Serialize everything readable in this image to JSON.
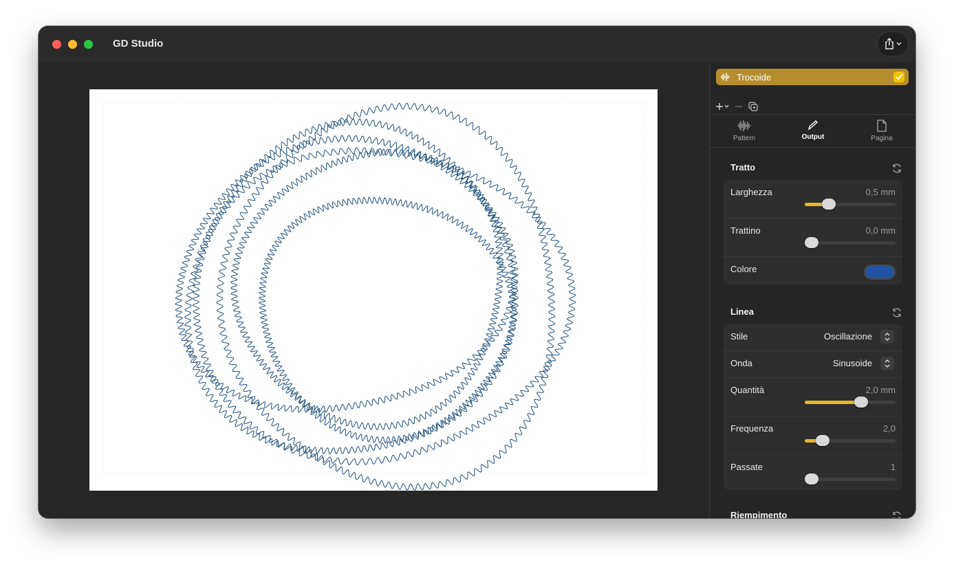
{
  "window": {
    "title": "GD Studio"
  },
  "canvas": {
    "stroke_color": "#1f4e7a"
  },
  "layer": {
    "name": "Trocoide",
    "color": "#b58d2e"
  },
  "tabs": [
    {
      "label": "Pattern",
      "icon": "waveform-icon"
    },
    {
      "label": "Output",
      "icon": "pencil-icon"
    },
    {
      "label": "Pagina",
      "icon": "document-icon"
    }
  ],
  "tratto": {
    "title": "Tratto",
    "larghezza": {
      "label": "Larghezza",
      "value": "0,5 mm",
      "fraction": 0.22
    },
    "trattino": {
      "label": "Trattino",
      "value": "0,0 mm",
      "fraction": 0.0
    },
    "colore": {
      "label": "Colore",
      "swatch": "#2151a0"
    }
  },
  "linea": {
    "title": "Linea",
    "stile": {
      "label": "Stile",
      "value": "Oscillazione"
    },
    "onda": {
      "label": "Onda",
      "value": "Sinusoide"
    },
    "quantita": {
      "label": "Quantità",
      "value": "2,0 mm",
      "fraction": 0.64
    },
    "frequenza": {
      "label": "Frequenza",
      "value": "2,0",
      "fraction": 0.14
    },
    "passate": {
      "label": "Passate",
      "value": "1",
      "fraction": 0.0
    }
  },
  "riempimento": {
    "title": "Riempimento"
  },
  "accent_color": "#e4b827"
}
